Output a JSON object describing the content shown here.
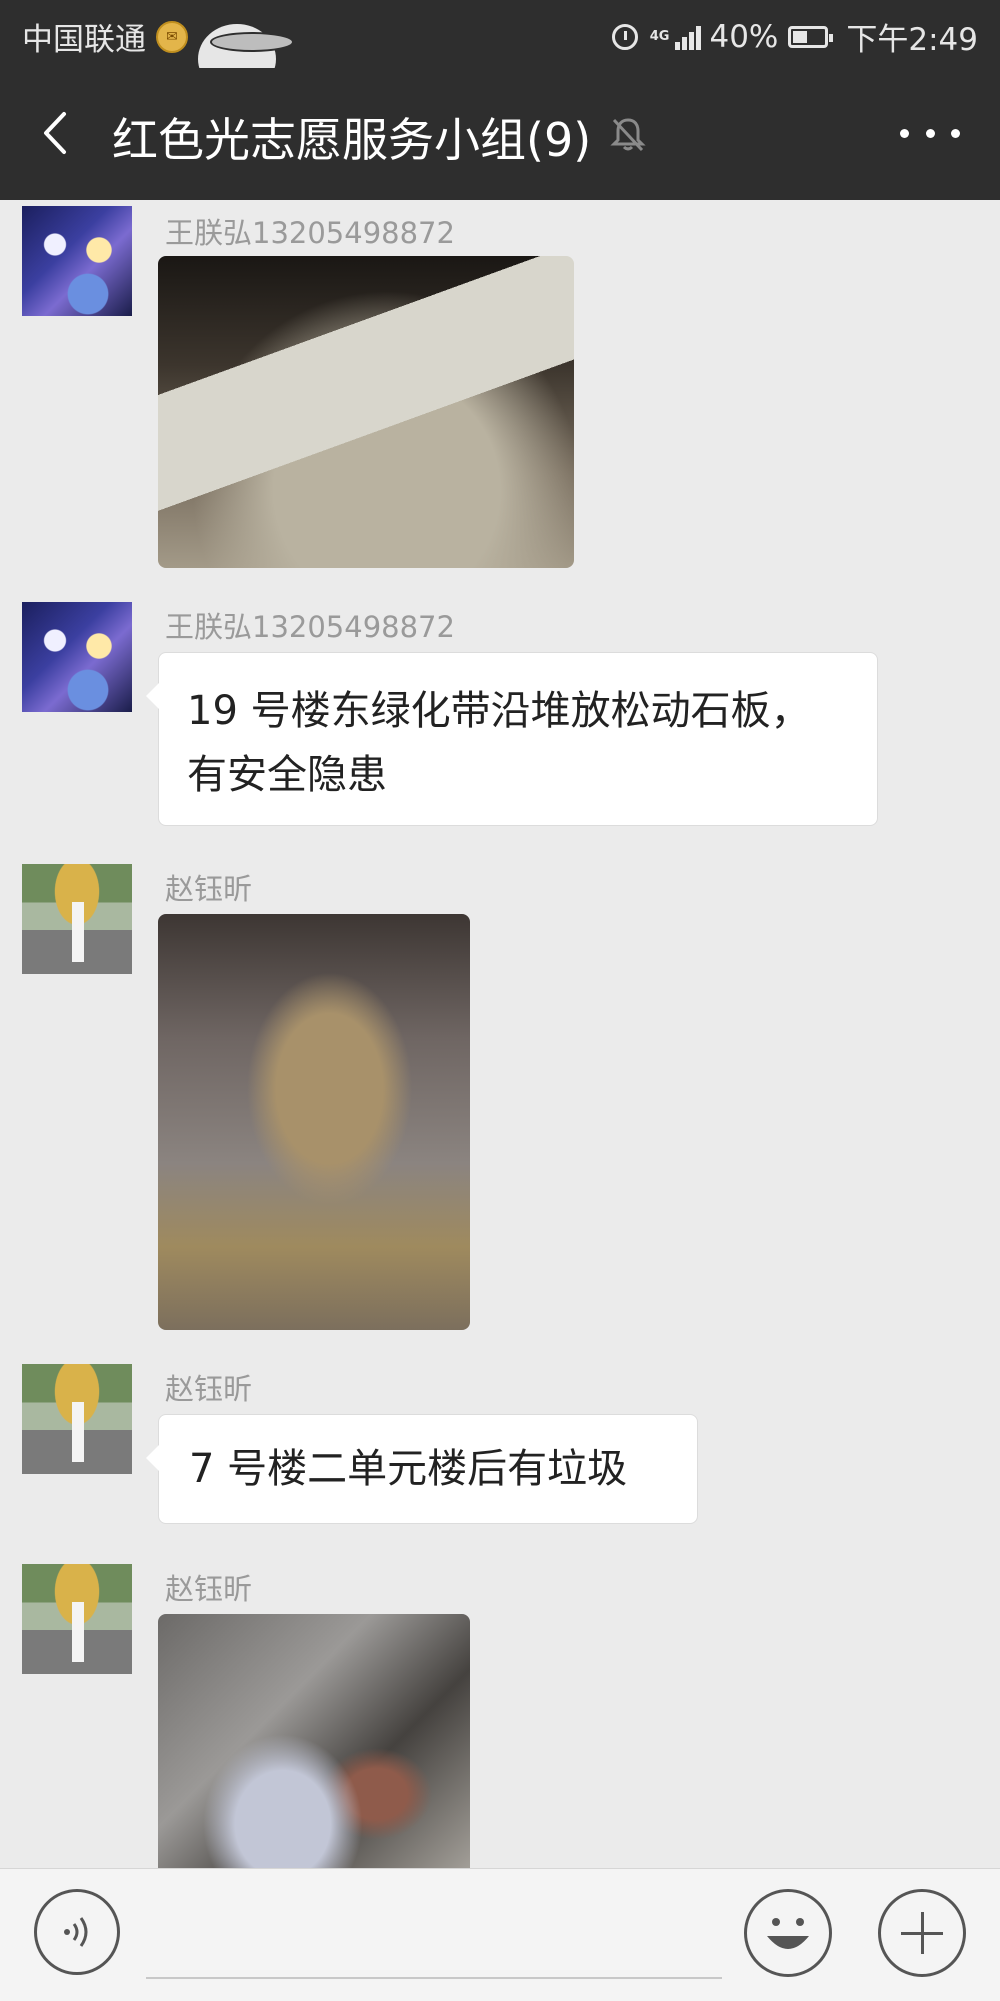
{
  "status_bar": {
    "carrier": "中国联通",
    "network": "4G",
    "battery": "40%",
    "time": "下午2:49"
  },
  "header": {
    "title": "红色光志愿服务小组(9)",
    "back_icon": "back-icon",
    "mute_icon": "bell-muted-icon",
    "more_icon": "more-icon"
  },
  "messages": [
    {
      "sender": "王朕弘13205498872",
      "type": "image",
      "avatar": "anime-avatar"
    },
    {
      "sender": "王朕弘13205498872",
      "type": "text",
      "text": "19 号楼东绿化带沿堆放松动石板，有安全隐患",
      "avatar": "anime-avatar"
    },
    {
      "sender": "赵钰昕",
      "type": "image",
      "avatar": "umbrella-avatar"
    },
    {
      "sender": "赵钰昕",
      "type": "text",
      "text": "7 号楼二单元楼后有垃圾",
      "avatar": "umbrella-avatar"
    },
    {
      "sender": "赵钰昕",
      "type": "image",
      "avatar": "umbrella-avatar"
    }
  ],
  "input_bar": {
    "voice_icon": "voice-icon",
    "emoji_icon": "emoji-icon",
    "plus_icon": "plus-icon"
  },
  "colors": {
    "header_bg": "#2e2e2e",
    "chat_bg": "#ebebeb",
    "bubble_bg": "#ffffff",
    "sender_text": "#9a9a9a"
  }
}
